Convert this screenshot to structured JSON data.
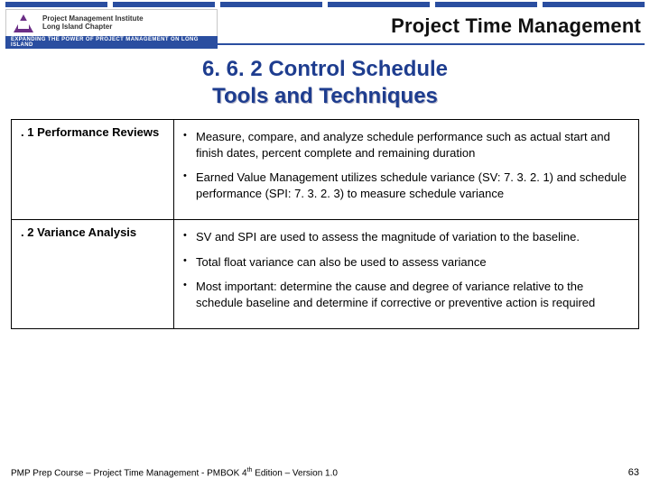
{
  "logo": {
    "line1": "Project Management Institute",
    "line2": "Long Island Chapter",
    "tagline": "EXPANDING THE POWER OF PROJECT MANAGEMENT ON LONG ISLAND"
  },
  "header": {
    "title": "Project Time Management"
  },
  "section": {
    "line1": "6. 6. 2 Control Schedule",
    "line2": "Tools and Techniques"
  },
  "rows": [
    {
      "label": ". 1 Performance Reviews",
      "bullets": [
        "Measure, compare, and analyze schedule performance such as actual start and finish dates, percent complete and remaining duration",
        "Earned Value Management utilizes schedule variance (SV: 7. 3. 2. 1) and schedule performance (SPI: 7. 3. 2. 3) to measure schedule variance"
      ]
    },
    {
      "label": ". 2 Variance Analysis",
      "bullets": [
        "SV and SPI are used to assess the magnitude of variation to the baseline.",
        "Total float variance can also be used to assess variance",
        "Most important: determine the cause and degree of variance relative to the schedule baseline and determine if corrective or preventive action is required"
      ]
    }
  ],
  "footer": {
    "text_prefix": "PMP Prep Course – Project Time Management - PMBOK 4",
    "text_sup": "th",
    "text_suffix": " Edition – Version 1.0",
    "page": "63"
  }
}
